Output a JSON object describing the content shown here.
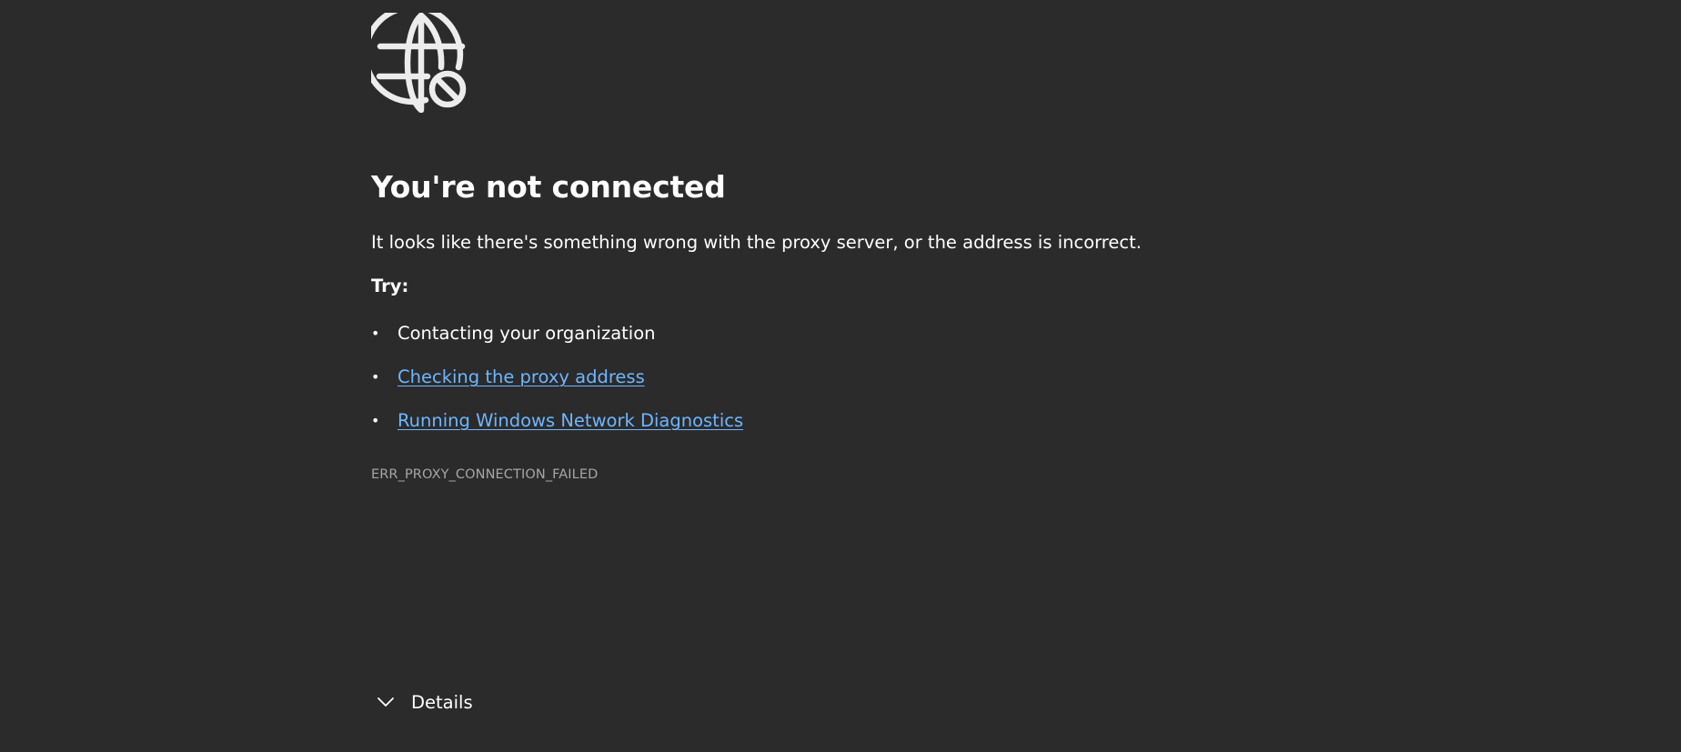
{
  "error_page": {
    "icon": "globe-blocked-icon",
    "title": "You're not connected",
    "description": "It looks like there's something wrong with the proxy server, or the address is incorrect.",
    "try_label": "Try:",
    "suggestions": [
      {
        "text": "Contacting your organization",
        "is_link": false
      },
      {
        "text": "Checking the proxy address",
        "is_link": true
      },
      {
        "text": "Running Windows Network Diagnostics",
        "is_link": true
      }
    ],
    "error_code": "ERR_PROXY_CONNECTION_FAILED",
    "details_label": "Details",
    "details_icon": "chevron-down-icon"
  },
  "colors": {
    "background": "#2b2b2b",
    "text": "#ffffff",
    "link": "#6fb6ff",
    "muted": "#a6a6a6"
  }
}
